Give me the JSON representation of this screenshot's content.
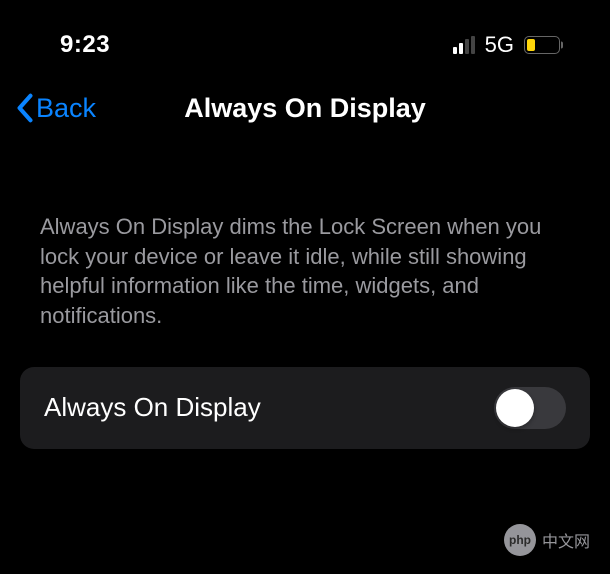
{
  "status": {
    "time": "9:23",
    "network": "5G",
    "signal_active_bars": 2,
    "signal_total_bars": 4,
    "battery_percent": 28,
    "battery_color": "#ffd60a"
  },
  "nav": {
    "back_label": "Back",
    "title": "Always On Display"
  },
  "description": "Always On Display dims the Lock Screen when you lock your device or leave it idle, while still showing helpful information like the time, widgets, and notifications.",
  "setting": {
    "label": "Always On Display",
    "enabled": false
  },
  "watermark": {
    "icon": "php",
    "text": "中文网"
  }
}
